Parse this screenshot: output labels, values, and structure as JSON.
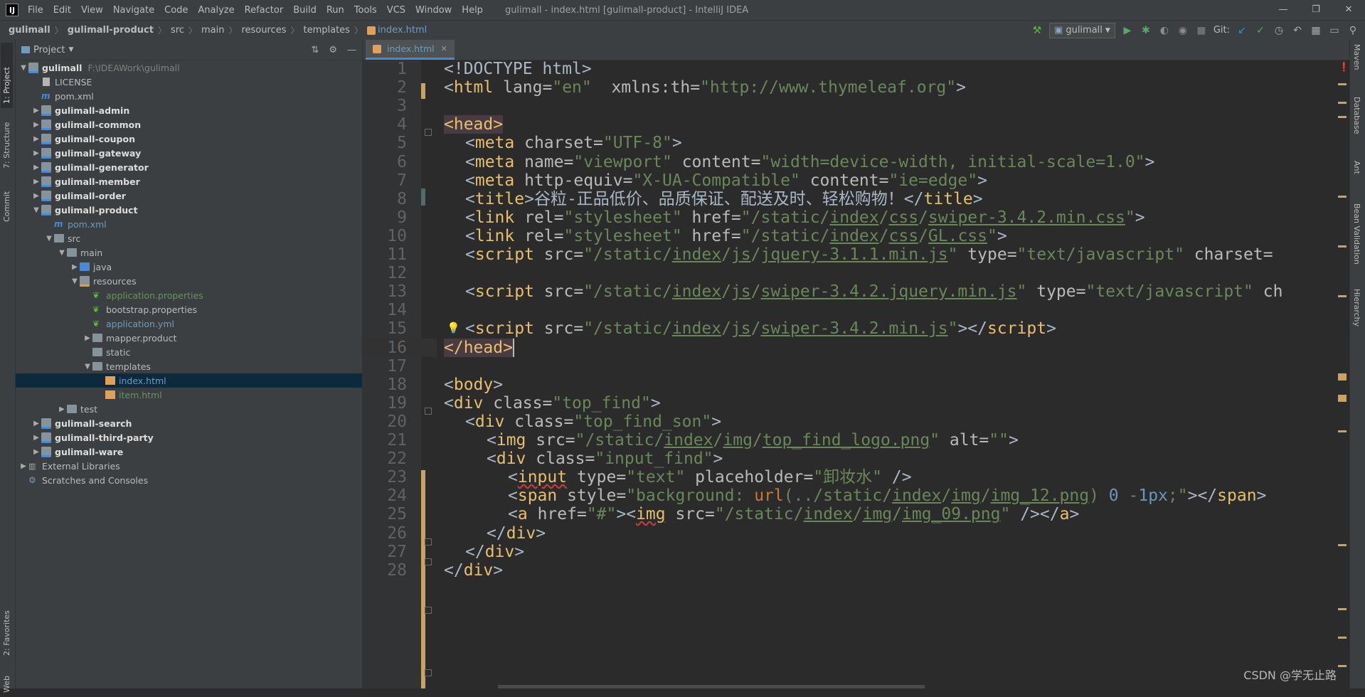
{
  "window": {
    "title": "gulimall - index.html [gulimall-product] - IntelliJ IDEA",
    "logo_text": "IJ",
    "controls": [
      "—",
      "❐",
      "✕"
    ]
  },
  "menu": [
    "File",
    "Edit",
    "View",
    "Navigate",
    "Code",
    "Analyze",
    "Refactor",
    "Build",
    "Run",
    "Tools",
    "VCS",
    "Window",
    "Help"
  ],
  "breadcrumb": [
    "gulimall",
    "gulimall-product",
    "src",
    "main",
    "resources",
    "templates",
    "index.html"
  ],
  "toolbar": {
    "run_config": "gulimall",
    "git_label": "Git:"
  },
  "left_tabs": [
    "1: Project",
    "7: Structure",
    "Commit",
    "2: Favorites",
    "Web"
  ],
  "right_tabs": [
    "Maven",
    "Database",
    "Ant",
    "Bean Validation",
    "Hierarchy"
  ],
  "project_panel": {
    "title": "Project",
    "tree": [
      {
        "label": "gulimall",
        "path": "F:\\IDEAWork\\gulimall",
        "indent": 0,
        "arrow": "▼",
        "icon": "folder-mod",
        "style": "bold"
      },
      {
        "label": "LICENSE",
        "indent": 1,
        "arrow": "",
        "icon": "file",
        "style": "normal"
      },
      {
        "label": "pom.xml",
        "indent": 1,
        "arrow": "",
        "icon": "maven",
        "style": "normal"
      },
      {
        "label": "gulimall-admin",
        "indent": 1,
        "arrow": "▶",
        "icon": "folder-mod",
        "style": "bold"
      },
      {
        "label": "gulimall-common",
        "indent": 1,
        "arrow": "▶",
        "icon": "folder-mod",
        "style": "bold"
      },
      {
        "label": "gulimall-coupon",
        "indent": 1,
        "arrow": "▶",
        "icon": "folder-mod",
        "style": "bold"
      },
      {
        "label": "gulimall-gateway",
        "indent": 1,
        "arrow": "▶",
        "icon": "folder-mod",
        "style": "bold"
      },
      {
        "label": "gulimall-generator",
        "indent": 1,
        "arrow": "▶",
        "icon": "folder-mod",
        "style": "bold"
      },
      {
        "label": "gulimall-member",
        "indent": 1,
        "arrow": "▶",
        "icon": "folder-mod",
        "style": "bold"
      },
      {
        "label": "gulimall-order",
        "indent": 1,
        "arrow": "▶",
        "icon": "folder-mod",
        "style": "bold"
      },
      {
        "label": "gulimall-product",
        "indent": 1,
        "arrow": "▼",
        "icon": "folder-mod",
        "style": "bold"
      },
      {
        "label": "pom.xml",
        "indent": 2,
        "arrow": "",
        "icon": "maven",
        "style": "blue"
      },
      {
        "label": "src",
        "indent": 2,
        "arrow": "▼",
        "icon": "folder",
        "style": "normal"
      },
      {
        "label": "main",
        "indent": 3,
        "arrow": "▼",
        "icon": "folder",
        "style": "normal"
      },
      {
        "label": "java",
        "indent": 4,
        "arrow": "▶",
        "icon": "folder-src",
        "style": "normal"
      },
      {
        "label": "resources",
        "indent": 4,
        "arrow": "▼",
        "icon": "folder-res",
        "style": "normal"
      },
      {
        "label": "application.properties",
        "indent": 5,
        "arrow": "",
        "icon": "leaf",
        "style": "green"
      },
      {
        "label": "bootstrap.properties",
        "indent": 5,
        "arrow": "",
        "icon": "leaf",
        "style": "normal"
      },
      {
        "label": "application.yml",
        "indent": 5,
        "arrow": "",
        "icon": "leaf",
        "style": "blue"
      },
      {
        "label": "mapper.product",
        "indent": 5,
        "arrow": "▶",
        "icon": "folder",
        "style": "normal"
      },
      {
        "label": "static",
        "indent": 5,
        "arrow": "",
        "icon": "folder",
        "style": "normal"
      },
      {
        "label": "templates",
        "indent": 5,
        "arrow": "▼",
        "icon": "folder",
        "style": "normal"
      },
      {
        "label": "index.html",
        "indent": 6,
        "arrow": "",
        "icon": "html",
        "style": "blue",
        "selected": true
      },
      {
        "label": "item.html",
        "indent": 6,
        "arrow": "",
        "icon": "html",
        "style": "green"
      },
      {
        "label": "test",
        "indent": 3,
        "arrow": "▶",
        "icon": "folder",
        "style": "normal"
      },
      {
        "label": "gulimall-search",
        "indent": 1,
        "arrow": "▶",
        "icon": "folder-mod",
        "style": "bold"
      },
      {
        "label": "gulimall-third-party",
        "indent": 1,
        "arrow": "▶",
        "icon": "folder-mod",
        "style": "bold"
      },
      {
        "label": "gulimall-ware",
        "indent": 1,
        "arrow": "▶",
        "icon": "folder-mod",
        "style": "bold"
      },
      {
        "label": "External Libraries",
        "indent": 0,
        "arrow": "▶",
        "icon": "libs",
        "style": "normal"
      },
      {
        "label": "Scratches and Consoles",
        "indent": 0,
        "arrow": "",
        "icon": "scratch",
        "style": "normal"
      }
    ]
  },
  "editor": {
    "tab_label": "index.html",
    "lines": [
      {
        "n": "1",
        "indent": 0,
        "parts": [
          [
            "tx",
            "<!DOCTYPE html>"
          ]
        ]
      },
      {
        "n": "2",
        "indent": 0,
        "parts": [
          [
            "tx",
            "<"
          ],
          [
            "tg",
            "html "
          ],
          [
            "at",
            "lang="
          ],
          [
            "av",
            "\"en\""
          ],
          [
            "at",
            "  xmlns:th="
          ],
          [
            "av",
            "\"http://www.thymeleaf.org\""
          ],
          [
            "tx",
            ">"
          ]
        ]
      },
      {
        "n": "3",
        "indent": 0,
        "parts": []
      },
      {
        "n": "4",
        "indent": 0,
        "parts": [
          [
            "hl",
            "<head>"
          ]
        ]
      },
      {
        "n": "5",
        "indent": 1,
        "parts": [
          [
            "tx",
            "<"
          ],
          [
            "tg",
            "meta "
          ],
          [
            "at",
            "charset="
          ],
          [
            "av",
            "\"UTF-8\""
          ],
          [
            "tx",
            ">"
          ]
        ]
      },
      {
        "n": "6",
        "indent": 1,
        "parts": [
          [
            "tx",
            "<"
          ],
          [
            "tg",
            "meta "
          ],
          [
            "at",
            "name="
          ],
          [
            "av",
            "\"viewport\""
          ],
          [
            "at",
            " content="
          ],
          [
            "av",
            "\"width=device-width, initial-scale=1.0\""
          ],
          [
            "tx",
            ">"
          ]
        ]
      },
      {
        "n": "7",
        "indent": 1,
        "parts": [
          [
            "tx",
            "<"
          ],
          [
            "tg",
            "meta "
          ],
          [
            "at",
            "http-equiv="
          ],
          [
            "av",
            "\"X-UA-Compatible\""
          ],
          [
            "at",
            " content="
          ],
          [
            "av",
            "\"ie=edge\""
          ],
          [
            "tx",
            ">"
          ]
        ]
      },
      {
        "n": "8",
        "indent": 1,
        "parts": [
          [
            "tx",
            "<"
          ],
          [
            "tg",
            "title"
          ],
          [
            "tx",
            ">谷粒-正品低价、品质保证、配送及时、轻松购物！</"
          ],
          [
            "tg",
            "title"
          ],
          [
            "tx",
            ">"
          ]
        ]
      },
      {
        "n": "9",
        "indent": 1,
        "parts": [
          [
            "tx",
            "<"
          ],
          [
            "tg",
            "link "
          ],
          [
            "at",
            "rel="
          ],
          [
            "av",
            "\"stylesheet\""
          ],
          [
            "at",
            " href="
          ],
          [
            "av",
            "\"/static/"
          ],
          [
            "avu",
            "index"
          ],
          [
            "av",
            "/"
          ],
          [
            "avu",
            "css"
          ],
          [
            "av",
            "/"
          ],
          [
            "avu",
            "swiper-3.4.2.min.css"
          ],
          [
            "av",
            "\""
          ],
          [
            "tx",
            ">"
          ]
        ]
      },
      {
        "n": "10",
        "indent": 1,
        "parts": [
          [
            "tx",
            "<"
          ],
          [
            "tg",
            "link "
          ],
          [
            "at",
            "rel="
          ],
          [
            "av",
            "\"stylesheet\""
          ],
          [
            "at",
            " href="
          ],
          [
            "av",
            "\"/static/"
          ],
          [
            "avu",
            "index"
          ],
          [
            "av",
            "/"
          ],
          [
            "avu",
            "css"
          ],
          [
            "av",
            "/"
          ],
          [
            "avu",
            "GL.css"
          ],
          [
            "av",
            "\""
          ],
          [
            "tx",
            ">"
          ]
        ]
      },
      {
        "n": "11",
        "indent": 1,
        "parts": [
          [
            "tx",
            "<"
          ],
          [
            "tg",
            "script "
          ],
          [
            "at",
            "src="
          ],
          [
            "av",
            "\"/static/"
          ],
          [
            "avu",
            "index"
          ],
          [
            "av",
            "/"
          ],
          [
            "avu",
            "js"
          ],
          [
            "av",
            "/"
          ],
          [
            "avu",
            "jquery-3.1.1.min.js"
          ],
          [
            "av",
            "\""
          ],
          [
            "at",
            " type="
          ],
          [
            "av",
            "\"text/javascript\""
          ],
          [
            "at",
            " charset="
          ]
        ]
      },
      {
        "n": "12",
        "indent": 0,
        "parts": []
      },
      {
        "n": "13",
        "indent": 1,
        "parts": [
          [
            "tx",
            "<"
          ],
          [
            "tg",
            "script "
          ],
          [
            "at",
            "src="
          ],
          [
            "av",
            "\"/static/"
          ],
          [
            "avu",
            "index"
          ],
          [
            "av",
            "/"
          ],
          [
            "avu",
            "js"
          ],
          [
            "av",
            "/"
          ],
          [
            "avu",
            "swiper-3.4.2.jquery.min.js"
          ],
          [
            "av",
            "\""
          ],
          [
            "at",
            " type="
          ],
          [
            "av",
            "\"text/javascript\""
          ],
          [
            "at",
            " ch"
          ]
        ]
      },
      {
        "n": "14",
        "indent": 0,
        "parts": []
      },
      {
        "n": "15",
        "indent": 1,
        "parts": [
          [
            "tx",
            "<"
          ],
          [
            "tg",
            "script "
          ],
          [
            "at",
            "src="
          ],
          [
            "av",
            "\"/static/"
          ],
          [
            "avu",
            "index"
          ],
          [
            "av",
            "/"
          ],
          [
            "avu",
            "js"
          ],
          [
            "av",
            "/"
          ],
          [
            "avu",
            "swiper-3.4.2.min.js"
          ],
          [
            "av",
            "\""
          ],
          [
            "tx",
            "></"
          ],
          [
            "tg",
            "script"
          ],
          [
            "tx",
            ">"
          ]
        ]
      },
      {
        "n": "16",
        "indent": 0,
        "parts": [
          [
            "hl",
            "</head>"
          ],
          [
            "cursor",
            ""
          ]
        ]
      },
      {
        "n": "17",
        "indent": 0,
        "parts": []
      },
      {
        "n": "18",
        "indent": 0,
        "parts": [
          [
            "tx",
            "<"
          ],
          [
            "tg",
            "body"
          ],
          [
            "tx",
            ">"
          ]
        ]
      },
      {
        "n": "19",
        "indent": 0,
        "parts": [
          [
            "tx",
            "<"
          ],
          [
            "tg",
            "div "
          ],
          [
            "at",
            "class="
          ],
          [
            "av",
            "\"top_find\""
          ],
          [
            "tx",
            ">"
          ]
        ]
      },
      {
        "n": "20",
        "indent": 1,
        "parts": [
          [
            "tx",
            "<"
          ],
          [
            "tg",
            "div "
          ],
          [
            "at",
            "class="
          ],
          [
            "av",
            "\"top_find_son\""
          ],
          [
            "tx",
            ">"
          ]
        ]
      },
      {
        "n": "21",
        "indent": 2,
        "parts": [
          [
            "tx",
            "<"
          ],
          [
            "tg",
            "img "
          ],
          [
            "at",
            "src="
          ],
          [
            "av",
            "\"/static/"
          ],
          [
            "avu",
            "index"
          ],
          [
            "av",
            "/"
          ],
          [
            "avu",
            "img"
          ],
          [
            "av",
            "/"
          ],
          [
            "avu",
            "top_find_logo.png"
          ],
          [
            "av",
            "\""
          ],
          [
            "at",
            " alt="
          ],
          [
            "av",
            "\"\""
          ],
          [
            "tx",
            ">"
          ]
        ]
      },
      {
        "n": "22",
        "indent": 2,
        "parts": [
          [
            "tx",
            "<"
          ],
          [
            "tg",
            "div "
          ],
          [
            "at",
            "class="
          ],
          [
            "av",
            "\"input_find\""
          ],
          [
            "tx",
            ">"
          ]
        ]
      },
      {
        "n": "23",
        "indent": 3,
        "parts": [
          [
            "tx",
            "<"
          ],
          [
            "tgs",
            "input"
          ],
          [
            "at",
            " type="
          ],
          [
            "av",
            "\"text\""
          ],
          [
            "at",
            " placeholder="
          ],
          [
            "av",
            "\"卸妆水\""
          ],
          [
            "tx",
            " />"
          ]
        ]
      },
      {
        "n": "24",
        "indent": 3,
        "parts": [
          [
            "tx",
            "<"
          ],
          [
            "tg",
            "span "
          ],
          [
            "at",
            "style="
          ],
          [
            "av",
            "\"background: "
          ],
          [
            "k",
            "url"
          ],
          [
            "av",
            "(../static/"
          ],
          [
            "avu",
            "index"
          ],
          [
            "av",
            "/"
          ],
          [
            "avu",
            "img"
          ],
          [
            "av",
            "/"
          ],
          [
            "avu",
            "img_12.png"
          ],
          [
            "av",
            ") "
          ],
          [
            "num",
            "0"
          ],
          [
            "av",
            " -"
          ],
          [
            "num",
            "1px"
          ],
          [
            "av",
            ";\""
          ],
          [
            "tx",
            "></"
          ],
          [
            "tg",
            "span"
          ],
          [
            "tx",
            ">"
          ]
        ]
      },
      {
        "n": "25",
        "indent": 3,
        "parts": [
          [
            "tx",
            "<"
          ],
          [
            "tg",
            "a "
          ],
          [
            "at",
            "href="
          ],
          [
            "av",
            "\"#\""
          ],
          [
            "tx",
            "><"
          ],
          [
            "tgs",
            "img"
          ],
          [
            "at",
            " src="
          ],
          [
            "av",
            "\"/static/"
          ],
          [
            "avu",
            "index"
          ],
          [
            "av",
            "/"
          ],
          [
            "avu",
            "img"
          ],
          [
            "av",
            "/"
          ],
          [
            "avu",
            "img_09.png"
          ],
          [
            "av",
            "\""
          ],
          [
            "tx",
            " /></"
          ],
          [
            "tg",
            "a"
          ],
          [
            "tx",
            ">"
          ]
        ]
      },
      {
        "n": "26",
        "indent": 2,
        "parts": [
          [
            "tx",
            "</"
          ],
          [
            "tg",
            "div"
          ],
          [
            "tx",
            ">"
          ]
        ]
      },
      {
        "n": "27",
        "indent": 1,
        "parts": [
          [
            "tx",
            "</"
          ],
          [
            "tg",
            "div"
          ],
          [
            "tx",
            ">"
          ]
        ]
      },
      {
        "n": "28",
        "indent": 0,
        "parts": [
          [
            "tx",
            "</"
          ],
          [
            "tg",
            "div"
          ],
          [
            "tx",
            ">"
          ]
        ]
      }
    ]
  },
  "watermark": "CSDN @学无止路"
}
